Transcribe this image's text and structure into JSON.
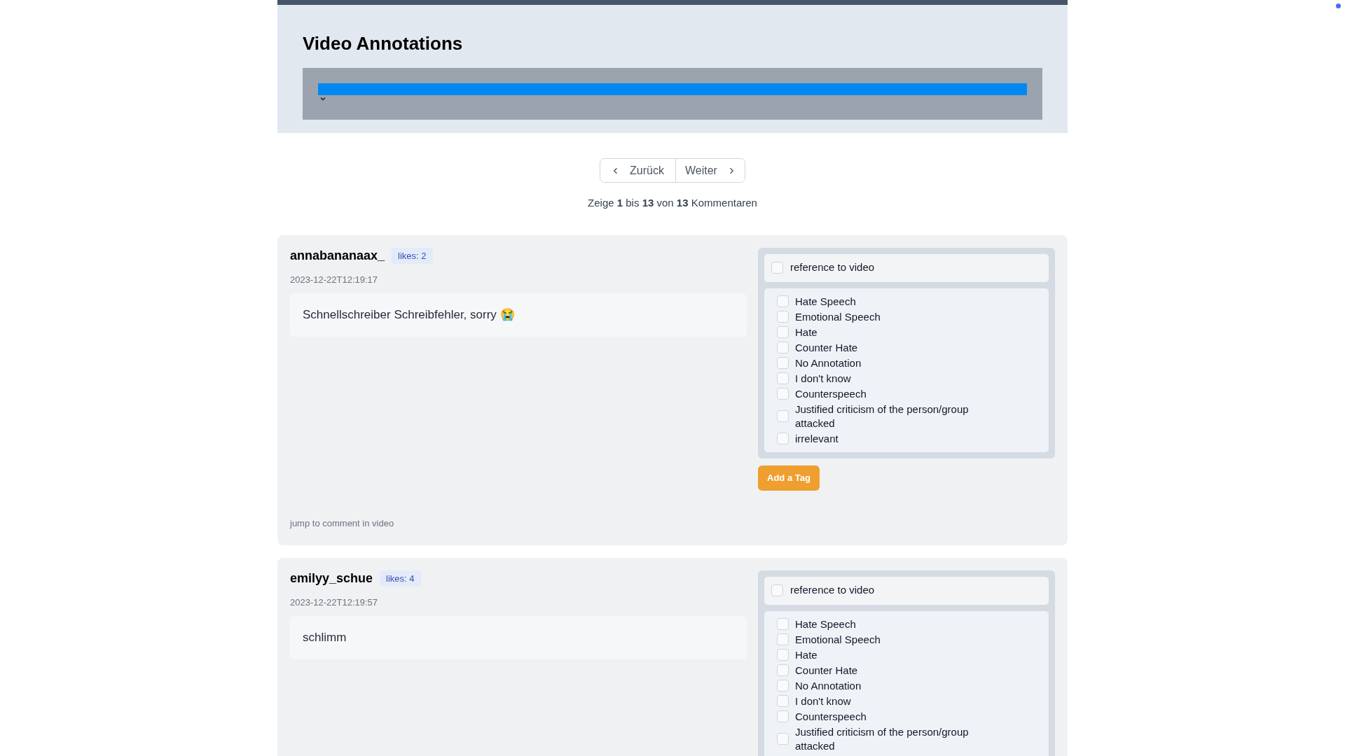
{
  "header": {
    "title": "Video Annotations"
  },
  "pagination": {
    "prev": "Zurück",
    "next": "Weiter",
    "summary": "Zeige **1** bis **13** von **13** Kommentaren"
  },
  "comments": [
    {
      "user": "annabananaax_",
      "likes": "likes: 2",
      "date": "2023-12-22T12:19:17",
      "text": "Schnellschreiber Schreibfehler, sorry 😭",
      "reference": {
        "label": "reference to video",
        "checked": false
      },
      "tags": [
        {
          "label": "Hate Speech",
          "checked": false
        },
        {
          "label": "Emotional Speech",
          "checked": false
        },
        {
          "label": "Hate",
          "checked": false
        },
        {
          "label": "Counter Hate",
          "checked": false
        },
        {
          "label": "No Annotation",
          "checked": false
        },
        {
          "label": "I don't know",
          "checked": false
        },
        {
          "label": "Counterspeech",
          "checked": false
        },
        {
          "label": "Justified criticism of the person/group attacked",
          "checked": false
        },
        {
          "label": "irrelevant",
          "checked": false
        }
      ],
      "add_tag": "Add a Tag",
      "jump": "jump to comment in video"
    },
    {
      "user": "emilyy_schue",
      "likes": "likes: 4",
      "date": "2023-12-22T12:19:57",
      "text": "schlimm",
      "reference": {
        "label": "reference to video",
        "checked": false
      },
      "tags": [
        {
          "label": "Hate Speech",
          "checked": false
        },
        {
          "label": "Emotional Speech",
          "checked": false
        },
        {
          "label": "Hate",
          "checked": false
        },
        {
          "label": "Counter Hate",
          "checked": false
        },
        {
          "label": "No Annotation",
          "checked": false
        },
        {
          "label": "I don't know",
          "checked": false
        },
        {
          "label": "Counterspeech",
          "checked": false
        },
        {
          "label": "Justified criticism of the person/group attacked",
          "checked": false
        }
      ]
    }
  ]
}
